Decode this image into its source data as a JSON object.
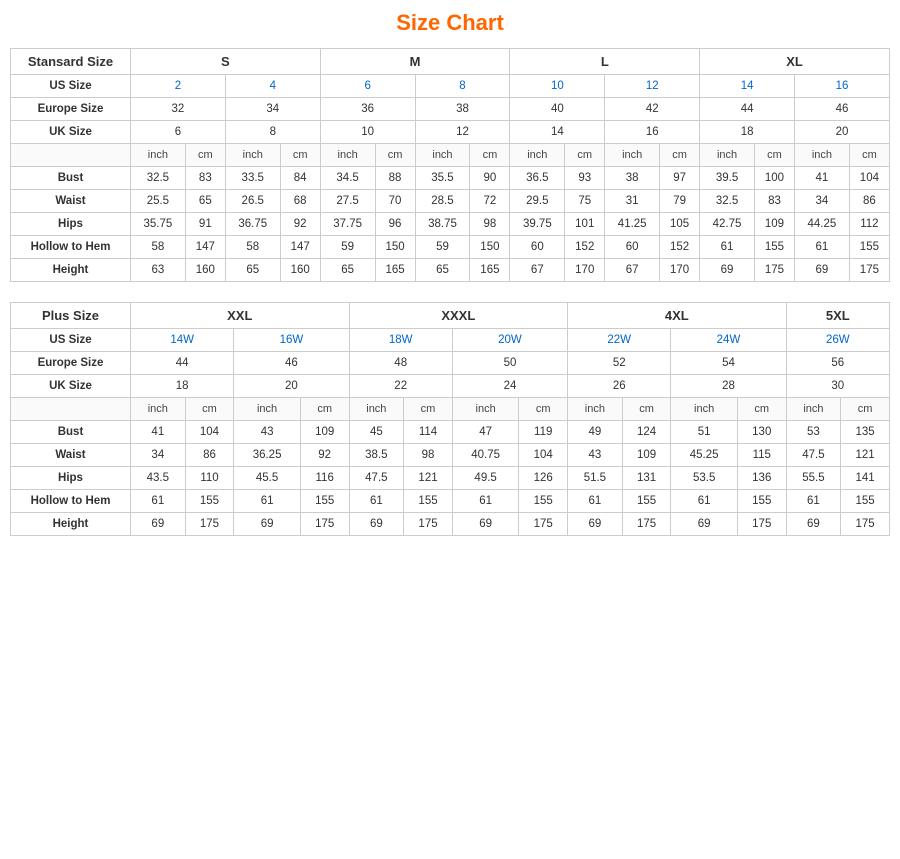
{
  "title": "Size Chart",
  "standard": {
    "headers": {
      "col1": "Stansard Size",
      "s": "S",
      "m": "M",
      "l": "L",
      "xl": "XL"
    },
    "usSize": {
      "label": "US Size",
      "values": [
        "2",
        "4",
        "6",
        "8",
        "10",
        "12",
        "14",
        "16"
      ]
    },
    "europeSize": {
      "label": "Europe Size",
      "values": [
        "32",
        "34",
        "36",
        "38",
        "40",
        "42",
        "44",
        "46"
      ]
    },
    "ukSize": {
      "label": "UK Size",
      "values": [
        "6",
        "8",
        "10",
        "12",
        "14",
        "16",
        "18",
        "20"
      ]
    },
    "unitRow": [
      "inch",
      "cm",
      "inch",
      "cm",
      "inch",
      "cm",
      "inch",
      "cm",
      "inch",
      "cm",
      "inch",
      "cm",
      "inch",
      "cm",
      "inch",
      "cm"
    ],
    "bust": {
      "label": "Bust",
      "values": [
        "32.5",
        "83",
        "33.5",
        "84",
        "34.5",
        "88",
        "35.5",
        "90",
        "36.5",
        "93",
        "38",
        "97",
        "39.5",
        "100",
        "41",
        "104"
      ]
    },
    "waist": {
      "label": "Waist",
      "values": [
        "25.5",
        "65",
        "26.5",
        "68",
        "27.5",
        "70",
        "28.5",
        "72",
        "29.5",
        "75",
        "31",
        "79",
        "32.5",
        "83",
        "34",
        "86"
      ]
    },
    "hips": {
      "label": "Hips",
      "values": [
        "35.75",
        "91",
        "36.75",
        "92",
        "37.75",
        "96",
        "38.75",
        "98",
        "39.75",
        "101",
        "41.25",
        "105",
        "42.75",
        "109",
        "44.25",
        "112"
      ]
    },
    "hollowToHem": {
      "label": "Hollow to Hem",
      "values": [
        "58",
        "147",
        "58",
        "147",
        "59",
        "150",
        "59",
        "150",
        "60",
        "152",
        "60",
        "152",
        "61",
        "155",
        "61",
        "155"
      ]
    },
    "height": {
      "label": "Height",
      "values": [
        "63",
        "160",
        "65",
        "160",
        "65",
        "165",
        "65",
        "165",
        "67",
        "170",
        "67",
        "170",
        "69",
        "175",
        "69",
        "175"
      ]
    }
  },
  "plus": {
    "headers": {
      "col1": "Plus Size",
      "xxl": "XXL",
      "xxxl": "XXXL",
      "fourxl": "4XL",
      "fivexl": "5XL"
    },
    "usSize": {
      "label": "US Size",
      "values": [
        "14W",
        "16W",
        "18W",
        "20W",
        "22W",
        "24W",
        "26W"
      ]
    },
    "europeSize": {
      "label": "Europe Size",
      "values": [
        "44",
        "46",
        "48",
        "50",
        "52",
        "54",
        "56"
      ]
    },
    "ukSize": {
      "label": "UK Size",
      "values": [
        "18",
        "20",
        "22",
        "24",
        "26",
        "28",
        "30"
      ]
    },
    "unitRow": [
      "inch",
      "cm",
      "inch",
      "cm",
      "inch",
      "cm",
      "inch",
      "cm",
      "inch",
      "cm",
      "inch",
      "cm",
      "inch",
      "cm"
    ],
    "bust": {
      "label": "Bust",
      "values": [
        "41",
        "104",
        "43",
        "109",
        "45",
        "114",
        "47",
        "119",
        "49",
        "124",
        "51",
        "130",
        "53",
        "135"
      ]
    },
    "waist": {
      "label": "Waist",
      "values": [
        "34",
        "86",
        "36.25",
        "92",
        "38.5",
        "98",
        "40.75",
        "104",
        "43",
        "109",
        "45.25",
        "115",
        "47.5",
        "121"
      ]
    },
    "hips": {
      "label": "Hips",
      "values": [
        "43.5",
        "110",
        "45.5",
        "116",
        "47.5",
        "121",
        "49.5",
        "126",
        "51.5",
        "131",
        "53.5",
        "136",
        "55.5",
        "141"
      ]
    },
    "hollowToHem": {
      "label": "Hollow to Hem",
      "values": [
        "61",
        "155",
        "61",
        "155",
        "61",
        "155",
        "61",
        "155",
        "61",
        "155",
        "61",
        "155",
        "61",
        "155"
      ]
    },
    "height": {
      "label": "Height",
      "values": [
        "69",
        "175",
        "69",
        "175",
        "69",
        "175",
        "69",
        "175",
        "69",
        "175",
        "69",
        "175",
        "69",
        "175"
      ]
    }
  }
}
